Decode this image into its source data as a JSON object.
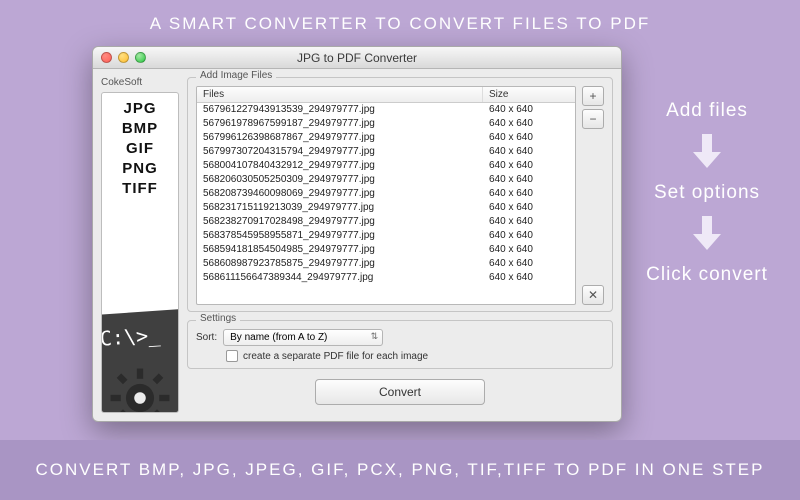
{
  "headline": "A SMART CONVERTER TO CONVERT FILES TO PDF",
  "footer": "CONVERT BMP, JPG, JPEG, GIF, PCX, PNG, TIF,TIFF TO PDF IN ONE STEP",
  "steps": [
    "Add files",
    "Set options",
    "Click convert"
  ],
  "window": {
    "title": "JPG to PDF Converter",
    "brand": "CokeSoft",
    "supported_formats": [
      "JPG",
      "BMP",
      "GIF",
      "PNG",
      "TIFF"
    ],
    "prompt_art_text": "C:\\>_",
    "groups": {
      "files_label": "Add Image Files",
      "settings_label": "Settings"
    },
    "table": {
      "col_files": "Files",
      "col_size": "Size",
      "rows": [
        {
          "file": "567961227943913539_294979777.jpg",
          "size": "640 x 640"
        },
        {
          "file": "567961978967599187_294979777.jpg",
          "size": "640 x 640"
        },
        {
          "file": "567996126398687867_294979777.jpg",
          "size": "640 x 640"
        },
        {
          "file": "567997307204315794_294979777.jpg",
          "size": "640 x 640"
        },
        {
          "file": "568004107840432912_294979777.jpg",
          "size": "640 x 640"
        },
        {
          "file": "568206030505250309_294979777.jpg",
          "size": "640 x 640"
        },
        {
          "file": "568208739460098069_294979777.jpg",
          "size": "640 x 640"
        },
        {
          "file": "568231715119213039_294979777.jpg",
          "size": "640 x 640"
        },
        {
          "file": "568238270917028498_294979777.jpg",
          "size": "640 x 640"
        },
        {
          "file": "568378545958955871_294979777.jpg",
          "size": "640 x 640"
        },
        {
          "file": "568594181854504985_294979777.jpg",
          "size": "640 x 640"
        },
        {
          "file": "568608987923785875_294979777.jpg",
          "size": "640 x 640"
        },
        {
          "file": "568611156647389344_294979777.jpg",
          "size": "640 x 640"
        }
      ]
    },
    "buttons": {
      "add": "+",
      "remove": "−",
      "clear": "✕",
      "convert": "Convert"
    },
    "settings": {
      "sort_label": "Sort:",
      "sort_value": "By name (from A to Z)",
      "checkbox_label": "create a separate PDF file for each image"
    }
  }
}
